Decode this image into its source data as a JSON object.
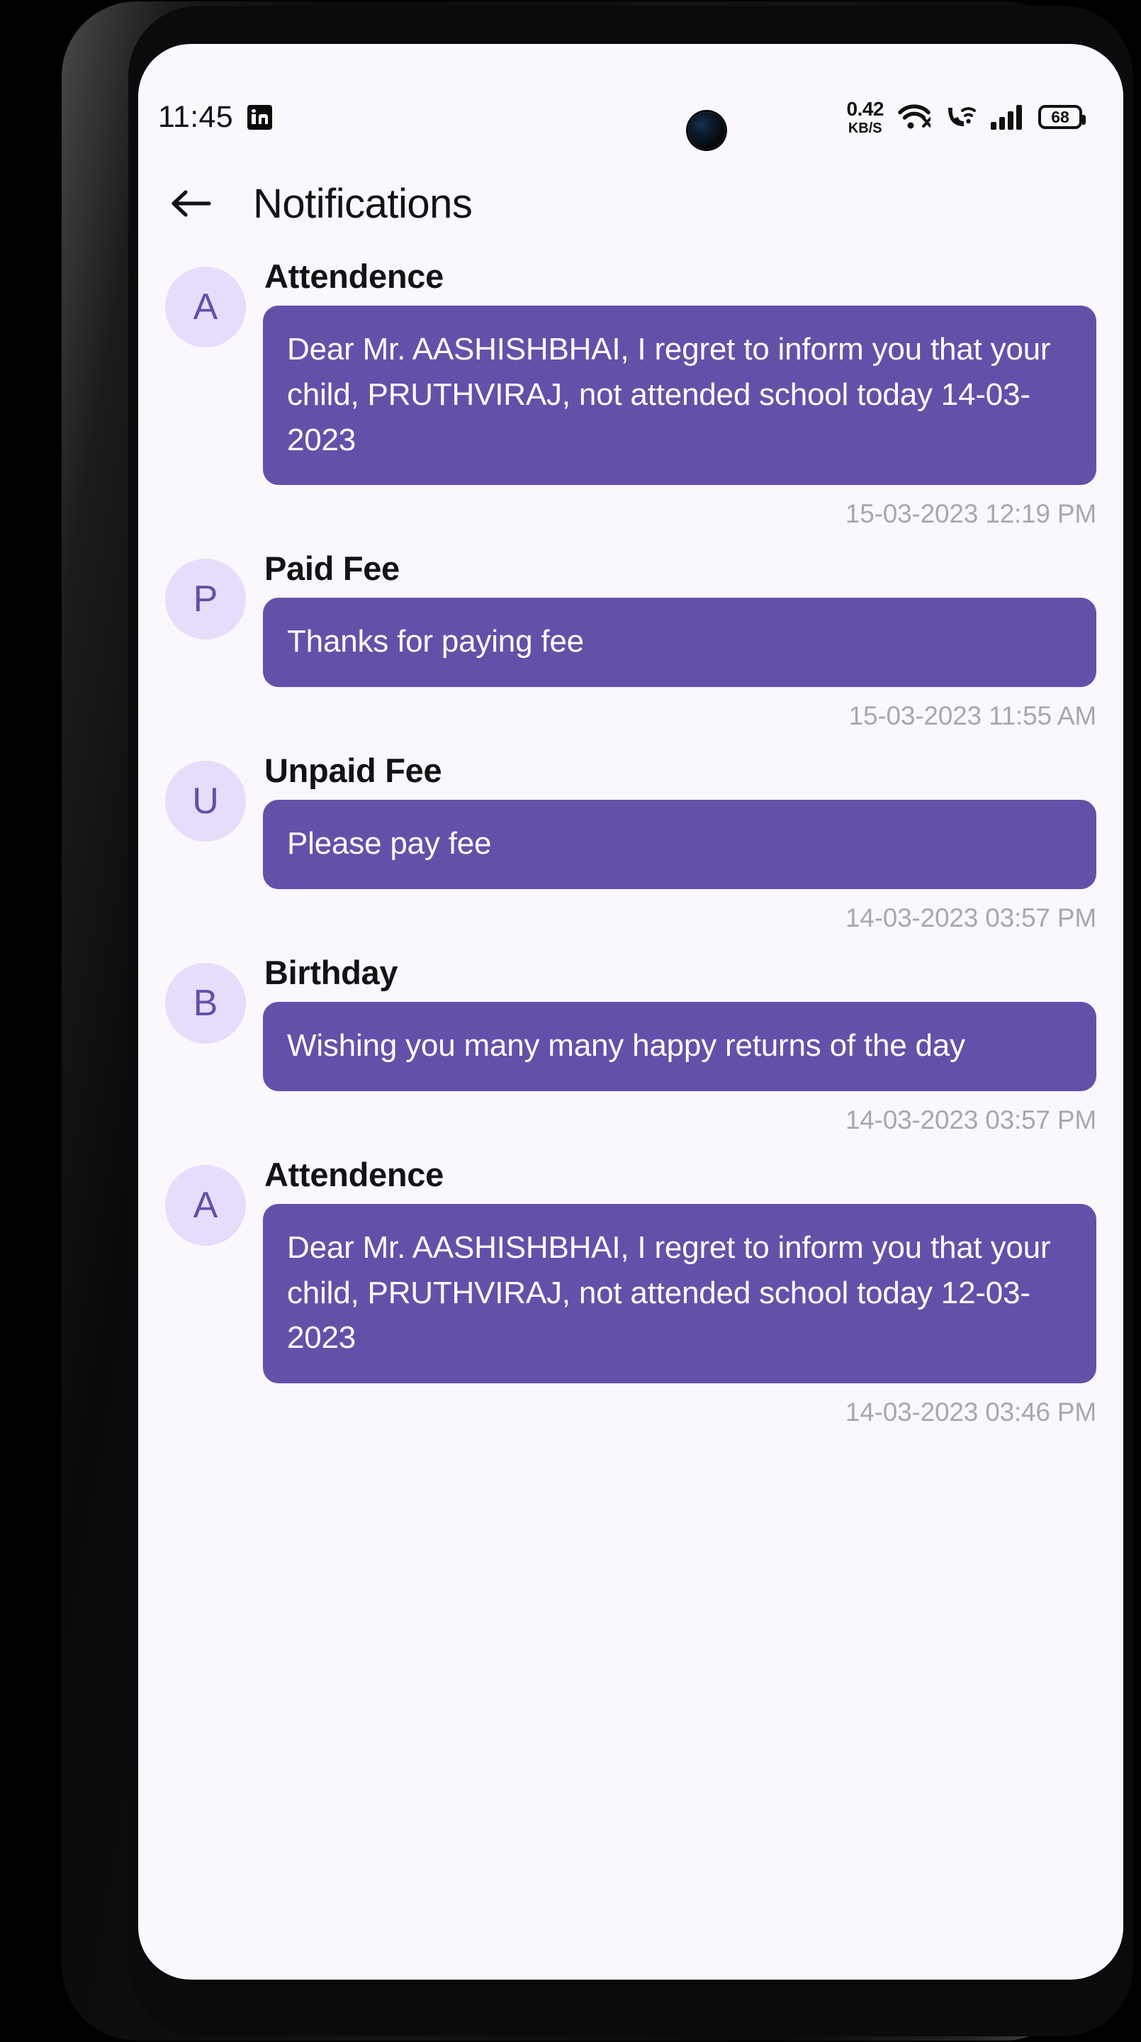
{
  "status_bar": {
    "time": "11:45",
    "app_icon": "linkedin-icon",
    "network_rate": "0.42",
    "network_unit": "KB/S",
    "icons": [
      "wifi-icon",
      "wifi-calling-icon",
      "cellular-signal-icon"
    ],
    "battery_level": "68"
  },
  "header": {
    "back_icon": "back-arrow-icon",
    "title": "Notifications"
  },
  "theme": {
    "bubble_color": "#6450A8",
    "avatar_bg": "#E7DDFB",
    "avatar_fg": "#6450A8",
    "screen_bg": "#FAF8FC",
    "timestamp_color": "#A9A6AE"
  },
  "notifications": [
    {
      "avatar": "A",
      "title": "Attendence",
      "message": "Dear Mr. AASHISHBHAI, I regret to inform you that your child, PRUTHVIRAJ, not attended school today 14-03-2023",
      "timestamp": "15-03-2023 12:19 PM"
    },
    {
      "avatar": "P",
      "title": "Paid Fee",
      "message": "Thanks for paying fee",
      "timestamp": "15-03-2023 11:55 AM"
    },
    {
      "avatar": "U",
      "title": "Unpaid Fee",
      "message": "Please pay fee",
      "timestamp": "14-03-2023 03:57 PM"
    },
    {
      "avatar": "B",
      "title": "Birthday",
      "message": "Wishing you many many happy returns of the day",
      "timestamp": "14-03-2023 03:57 PM"
    },
    {
      "avatar": "A",
      "title": "Attendence",
      "message": "Dear Mr. AASHISHBHAI, I regret to inform you that your child, PRUTHVIRAJ, not attended school today 12-03-2023",
      "timestamp": "14-03-2023 03:46 PM"
    }
  ]
}
